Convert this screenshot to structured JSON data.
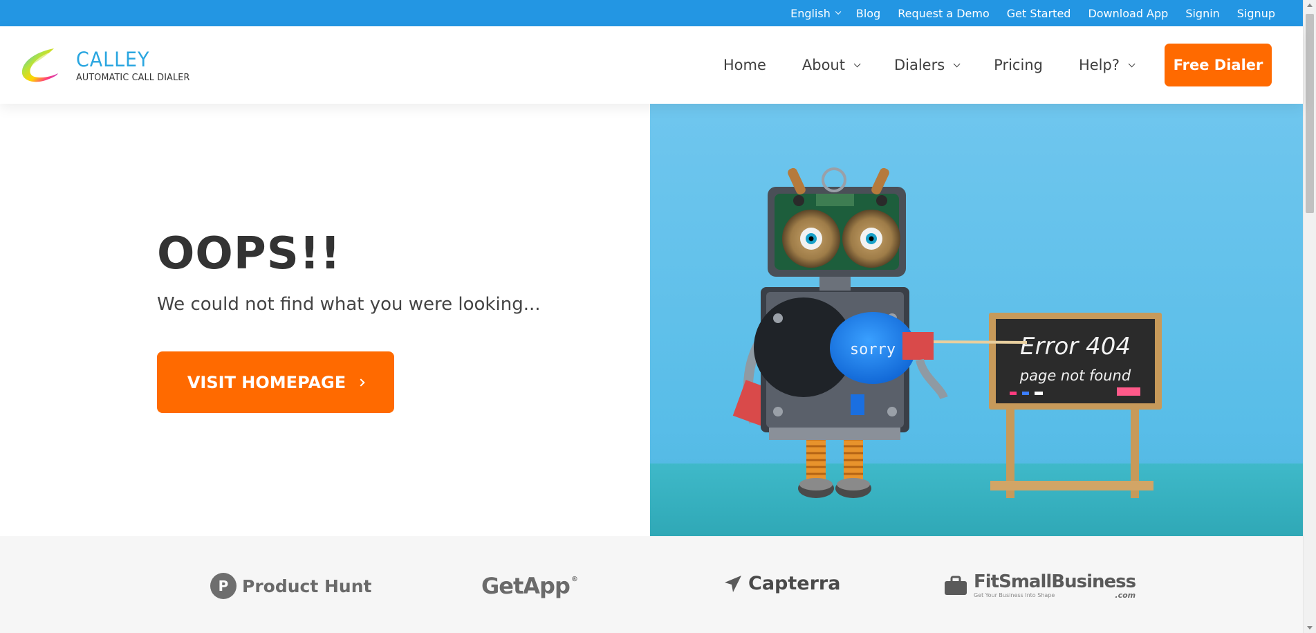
{
  "topbar": {
    "links": [
      {
        "label": "English",
        "has_dropdown": true
      },
      {
        "label": "Blog"
      },
      {
        "label": "Request a Demo"
      },
      {
        "label": "Get Started"
      },
      {
        "label": "Download App"
      },
      {
        "label": "Signin"
      },
      {
        "label": "Signup"
      }
    ]
  },
  "header": {
    "logo_title": "CALLEY",
    "logo_subtitle": "AUTOMATIC CALL DIALER",
    "nav": [
      {
        "label": "Home",
        "has_dropdown": false
      },
      {
        "label": "About",
        "has_dropdown": true
      },
      {
        "label": "Dialers",
        "has_dropdown": true
      },
      {
        "label": "Pricing",
        "has_dropdown": false
      },
      {
        "label": "Help?",
        "has_dropdown": true
      }
    ],
    "cta_label": "Free Dialer"
  },
  "main": {
    "heading": "OOPS!!",
    "message": "We could not find what you were looking...",
    "button_label": "VISIT HOMEPAGE",
    "illustration": {
      "screen_text": "sorry",
      "board_line1": "Error 404",
      "board_line2": "page not found"
    }
  },
  "brands": {
    "product_hunt": {
      "badge": "P",
      "name": "Product Hunt"
    },
    "getapp": {
      "name": "GetApp",
      "mark": "®"
    },
    "capterra": {
      "name": "Capterra"
    },
    "fitsmallbusiness": {
      "name": "FitSmallBusiness",
      "suffix": ".com",
      "tagline": "Get Your Business Into Shape"
    }
  },
  "colors": {
    "topbar": "#2396e3",
    "accent_orange": "#ff6a00",
    "logo_blue": "#2aa6e0",
    "sky_blue": "#58bde8"
  }
}
